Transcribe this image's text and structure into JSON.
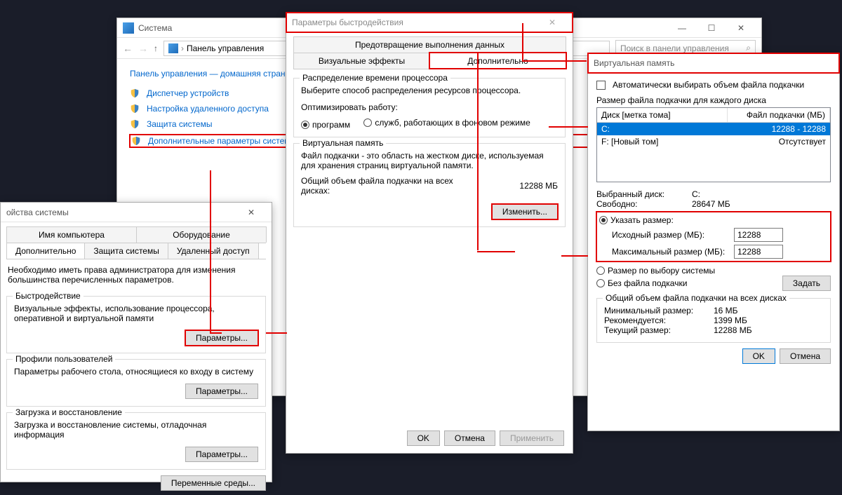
{
  "sys_window": {
    "title": "Система",
    "breadcrumb": "Панель управления",
    "search_ph": "Поиск в панели управления",
    "home": "Панель управления — домашняя страница",
    "links": [
      "Диспетчер устройств",
      "Настройка удаленного доступа",
      "Защита системы",
      "Дополнительные параметры системы"
    ]
  },
  "props": {
    "title_partial": "ойства системы",
    "tabs": [
      "Имя компьютера",
      "Оборудование",
      "Дополнительно",
      "Защита системы",
      "Удаленный доступ"
    ],
    "admin_note": "Необходимо иметь права администратора для изменения большинства перечисленных параметров.",
    "perf_title": "Быстродействие",
    "perf_desc": "Визуальные эффекты, использование процессора, оперативной и виртуальной памяти",
    "profiles_title": "Профили пользователей",
    "profiles_desc": "Параметры рабочего стола, относящиеся ко входу в систему",
    "startup_title": "Загрузка и восстановление",
    "startup_desc": "Загрузка и восстановление системы, отладочная информация",
    "params_btn": "Параметры...",
    "env_btn": "Переменные среды..."
  },
  "perf": {
    "title": "Параметры быстродействия",
    "tab_dep": "Предотвращение выполнения данных",
    "tab_visual": "Визуальные эффекты",
    "tab_adv": "Дополнительно",
    "cpu_title": "Распределение времени процессора",
    "cpu_desc": "Выберите способ распределения ресурсов процессора.",
    "optimize": "Оптимизировать работу:",
    "opt_programs": "программ",
    "opt_services": "служб, работающих в фоновом режиме",
    "vm_title": "Виртуальная память",
    "vm_desc": "Файл подкачки - это область на жестком диске, используемая для хранения страниц виртуальной памяти.",
    "vm_total": "Общий объем файла подкачки на всех дисках:",
    "vm_total_val": "12288 МБ",
    "change_btn": "Изменить...",
    "ok": "OK",
    "cancel": "Отмена",
    "apply": "Применить"
  },
  "vmem": {
    "title": "Виртуальная память",
    "auto": "Автоматически выбирать объем файла подкачки",
    "per_drive": "Размер файла подкачки для каждого диска",
    "col_drive": "Диск [метка тома]",
    "col_size": "Файл подкачки (МБ)",
    "drive_c": "C:",
    "drive_c_size": "12288 - 12288",
    "drive_f": "F:    [Новый том]",
    "drive_f_size": "Отсутствует",
    "selected_drive_lbl": "Выбранный диск:",
    "selected_drive": "C:",
    "free_lbl": "Свободно:",
    "free": "28647 МБ",
    "custom": "Указать размер:",
    "initial_lbl": "Исходный размер (МБ):",
    "initial": "12288",
    "max_lbl": "Максимальный размер (МБ):",
    "max": "12288",
    "system": "Размер по выбору системы",
    "none": "Без файла подкачки",
    "set_btn": "Задать",
    "total_title": "Общий объем файла подкачки на всех дисках",
    "min_lbl": "Минимальный размер:",
    "min": "16 МБ",
    "rec_lbl": "Рекомендуется:",
    "rec": "1399 МБ",
    "cur_lbl": "Текущий размер:",
    "cur": "12288 МБ",
    "ok": "OK",
    "cancel": "Отмена"
  }
}
